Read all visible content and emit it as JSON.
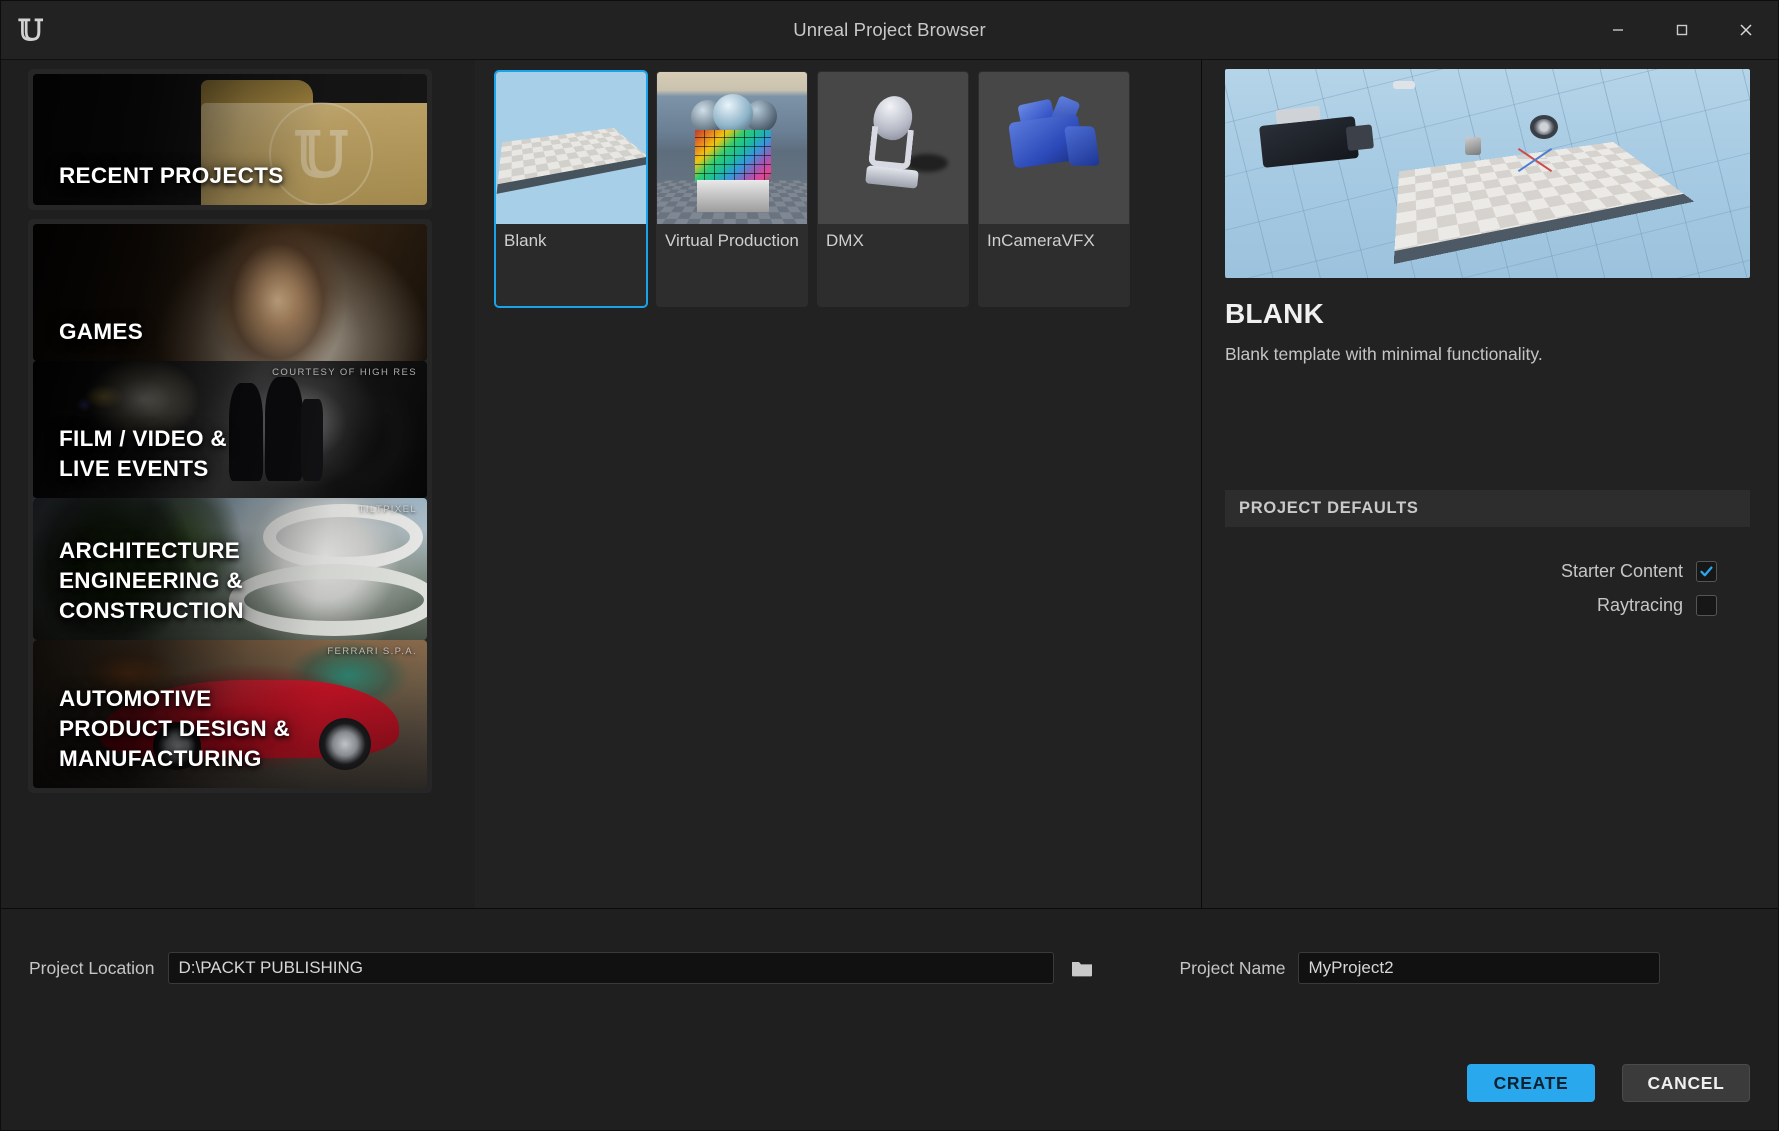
{
  "window": {
    "title": "Unreal Project Browser",
    "logo_glyph": "U",
    "controls": {
      "minimize": "minimize-icon",
      "maximize": "maximize-icon",
      "close": "close-icon"
    }
  },
  "sidebar": {
    "recent": {
      "label": "RECENT PROJECTS",
      "selected": false
    },
    "categories": [
      {
        "label": "GAMES",
        "credit": "",
        "selected": false,
        "art": "games"
      },
      {
        "label": "FILM / VIDEO &\nLIVE EVENTS",
        "credit": "COURTESY OF HIGH RES",
        "selected": true,
        "art": "film"
      },
      {
        "label": "ARCHITECTURE\nENGINEERING &\nCONSTRUCTION",
        "credit": "TILTPIXEL",
        "selected": false,
        "art": "arch"
      },
      {
        "label": "AUTOMOTIVE\nPRODUCT DESIGN &\nMANUFACTURING",
        "credit": "FERRARI S.P.A.",
        "selected": false,
        "art": "auto"
      }
    ]
  },
  "templates": [
    {
      "name": "Blank",
      "selected": true,
      "thumb": "blank-plane-thumbnail"
    },
    {
      "name": "Virtual Production",
      "selected": false,
      "thumb": "color-cube-thumbnail"
    },
    {
      "name": "DMX",
      "selected": false,
      "thumb": "moving-light-thumbnail"
    },
    {
      "name": "InCameraVFX",
      "selected": false,
      "thumb": "camera-thumbnail"
    }
  ],
  "detail": {
    "preview_alt": "blank-level-preview",
    "title": "BLANK",
    "description": "Blank template with minimal functionality.",
    "defaults_header": "PROJECT DEFAULTS",
    "options": [
      {
        "label": "Starter Content",
        "checked": true
      },
      {
        "label": "Raytracing",
        "checked": false
      }
    ]
  },
  "footer": {
    "location_label": "Project Location",
    "location_value": "D:\\PACKT PUBLISHING",
    "location_placeholder": "",
    "browse_icon": "folder-icon",
    "name_label": "Project Name",
    "name_value": "MyProject2",
    "name_placeholder": "",
    "create_label": "CREATE",
    "cancel_label": "CANCEL"
  },
  "colors": {
    "accent": "#2aa8ee",
    "selection_border": "#17a2e8",
    "window_bg": "#1f1f1f",
    "panel_bg": "#222222",
    "card_bg": "#2d2d2d"
  }
}
